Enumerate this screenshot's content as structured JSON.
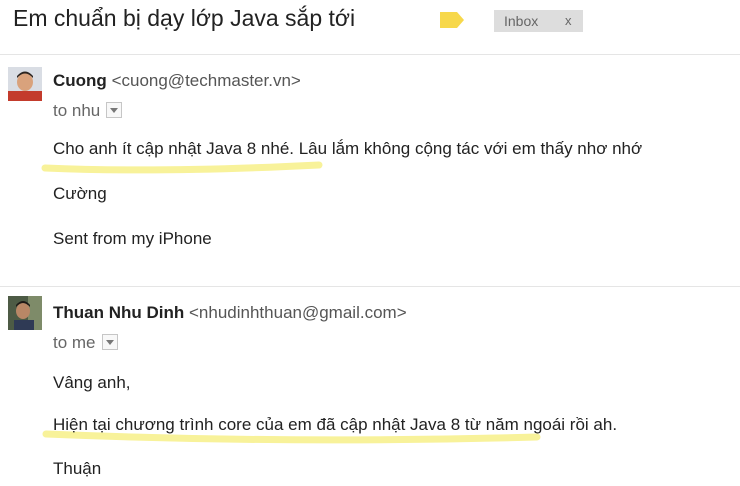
{
  "subject": "Em chuẩn bị dạy lớp Java sắp tới",
  "label_color": "#f7d84b",
  "inbox_tag": {
    "label": "Inbox",
    "close": "x"
  },
  "highlight_color": "#f8f29a",
  "messages": [
    {
      "sender_name": "Cuong",
      "sender_email": "<cuong@techmaster.vn>",
      "to": "to nhu",
      "body": [
        "Cho anh ít cập nhật Java 8 nhé. Lâu lắm không cộng tác với em thấy nhơ nhớ",
        "Cường",
        "Sent from my iPhone"
      ]
    },
    {
      "sender_name": "Thuan Nhu Dinh",
      "sender_email": "<nhudinhthuan@gmail.com>",
      "to": "to me",
      "body": [
        "Vâng anh,",
        "Hiện tại chương trình core của em đã cập nhật Java 8 từ năm ngoái rồi ah.",
        "Thuận"
      ]
    }
  ]
}
